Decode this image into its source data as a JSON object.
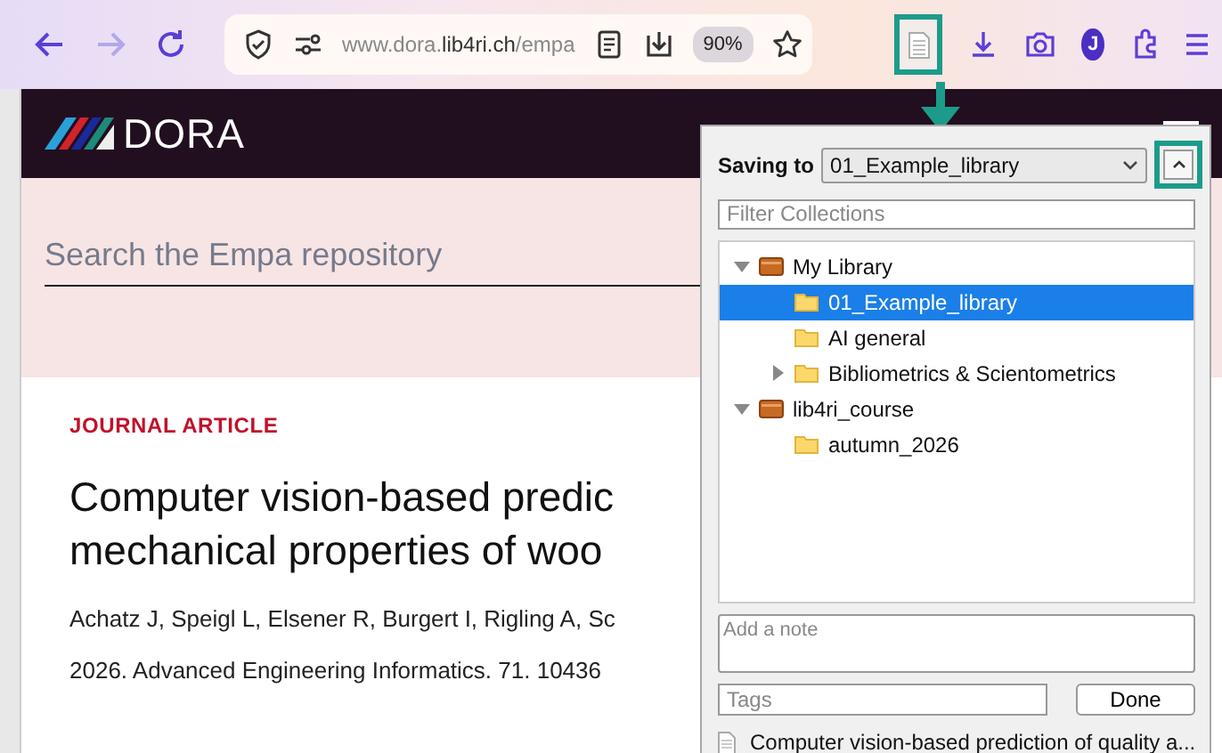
{
  "toolbar": {
    "url": "www.dora.**lib4ri.ch**/empa",
    "zoom": "90%",
    "profile_initial": "J"
  },
  "site": {
    "logo": "DORA",
    "search": {
      "placeholder": "Search the Empa repository"
    }
  },
  "article": {
    "type": "JOURNAL ARTICLE",
    "title_lines": [
      "Computer vision-based predic",
      "mechanical properties of woo"
    ],
    "authors": "Achatz J, Speigl L, Elsener R, Burgert I, Rigling A, Sc",
    "citation": "2026. Advanced Engineering Informatics. 71. 10436"
  },
  "popup": {
    "saving_to_label": "Saving to",
    "target": "01_Example_library",
    "filter": {
      "placeholder": "Filter Collections"
    },
    "tree": [
      {
        "kind": "library",
        "label": "My Library",
        "selected": false,
        "expanded": true,
        "children": [
          {
            "kind": "collection",
            "label": "01_Example_library",
            "selected": true
          },
          {
            "kind": "collection",
            "label": "AI general",
            "selected": false
          },
          {
            "kind": "collection",
            "label": "Bibliometrics & Scientometrics",
            "selected": false,
            "expanded": false
          }
        ]
      },
      {
        "kind": "library",
        "label": "lib4ri_course",
        "selected": false,
        "expanded": true,
        "children": [
          {
            "kind": "collection",
            "label": "autumn_2026",
            "selected": false
          }
        ]
      }
    ],
    "note": {
      "placeholder": "Add a note"
    },
    "tags": {
      "placeholder": "Tags"
    },
    "done_button": "Done",
    "item": "Computer vision-based prediction of quality a..."
  }
}
